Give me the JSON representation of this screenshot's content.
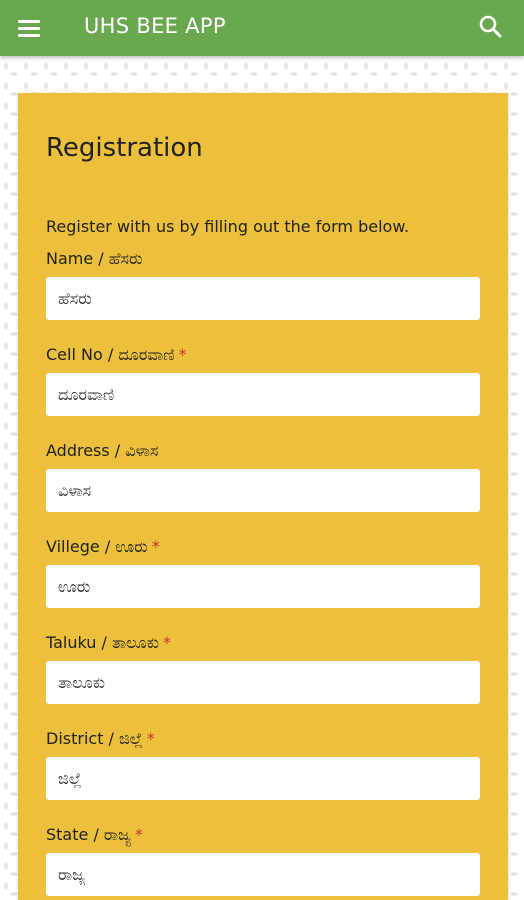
{
  "appbar": {
    "title": "UHS BEE APP",
    "menu_icon": "hamburger-menu-icon",
    "search_icon": "search-icon",
    "color": "#6aa84f"
  },
  "form": {
    "title": "Registration",
    "intro": "Register with us by filling out the form below.",
    "background_color": "#ecbf3c",
    "required_color": "#c0392b",
    "fields": [
      {
        "label": "Name / ಹೆಸರು",
        "required": false,
        "placeholder": "ಹೆಸರು",
        "value": ""
      },
      {
        "label": "Cell No / ದೂರವಾಣಿ",
        "required": true,
        "placeholder": "ದೂರವಾಣಿ",
        "value": ""
      },
      {
        "label": "Address / ವಿಳಾಸ",
        "required": false,
        "placeholder": "ವಿಳಾಸ",
        "value": ""
      },
      {
        "label": "Villege / ಊರು",
        "required": true,
        "placeholder": "ಊರು",
        "value": ""
      },
      {
        "label": "Taluku / ತಾಲೂಕು",
        "required": true,
        "placeholder": "ತಾಲೂಕು",
        "value": ""
      },
      {
        "label": "District / ಜಿಲ್ಲೆ",
        "required": true,
        "placeholder": "ಜಿಲ್ಲೆ",
        "value": ""
      },
      {
        "label": "State / ರಾಜ್ಯ",
        "required": true,
        "placeholder": "ರಾಜ್ಯ",
        "value": ""
      }
    ]
  }
}
